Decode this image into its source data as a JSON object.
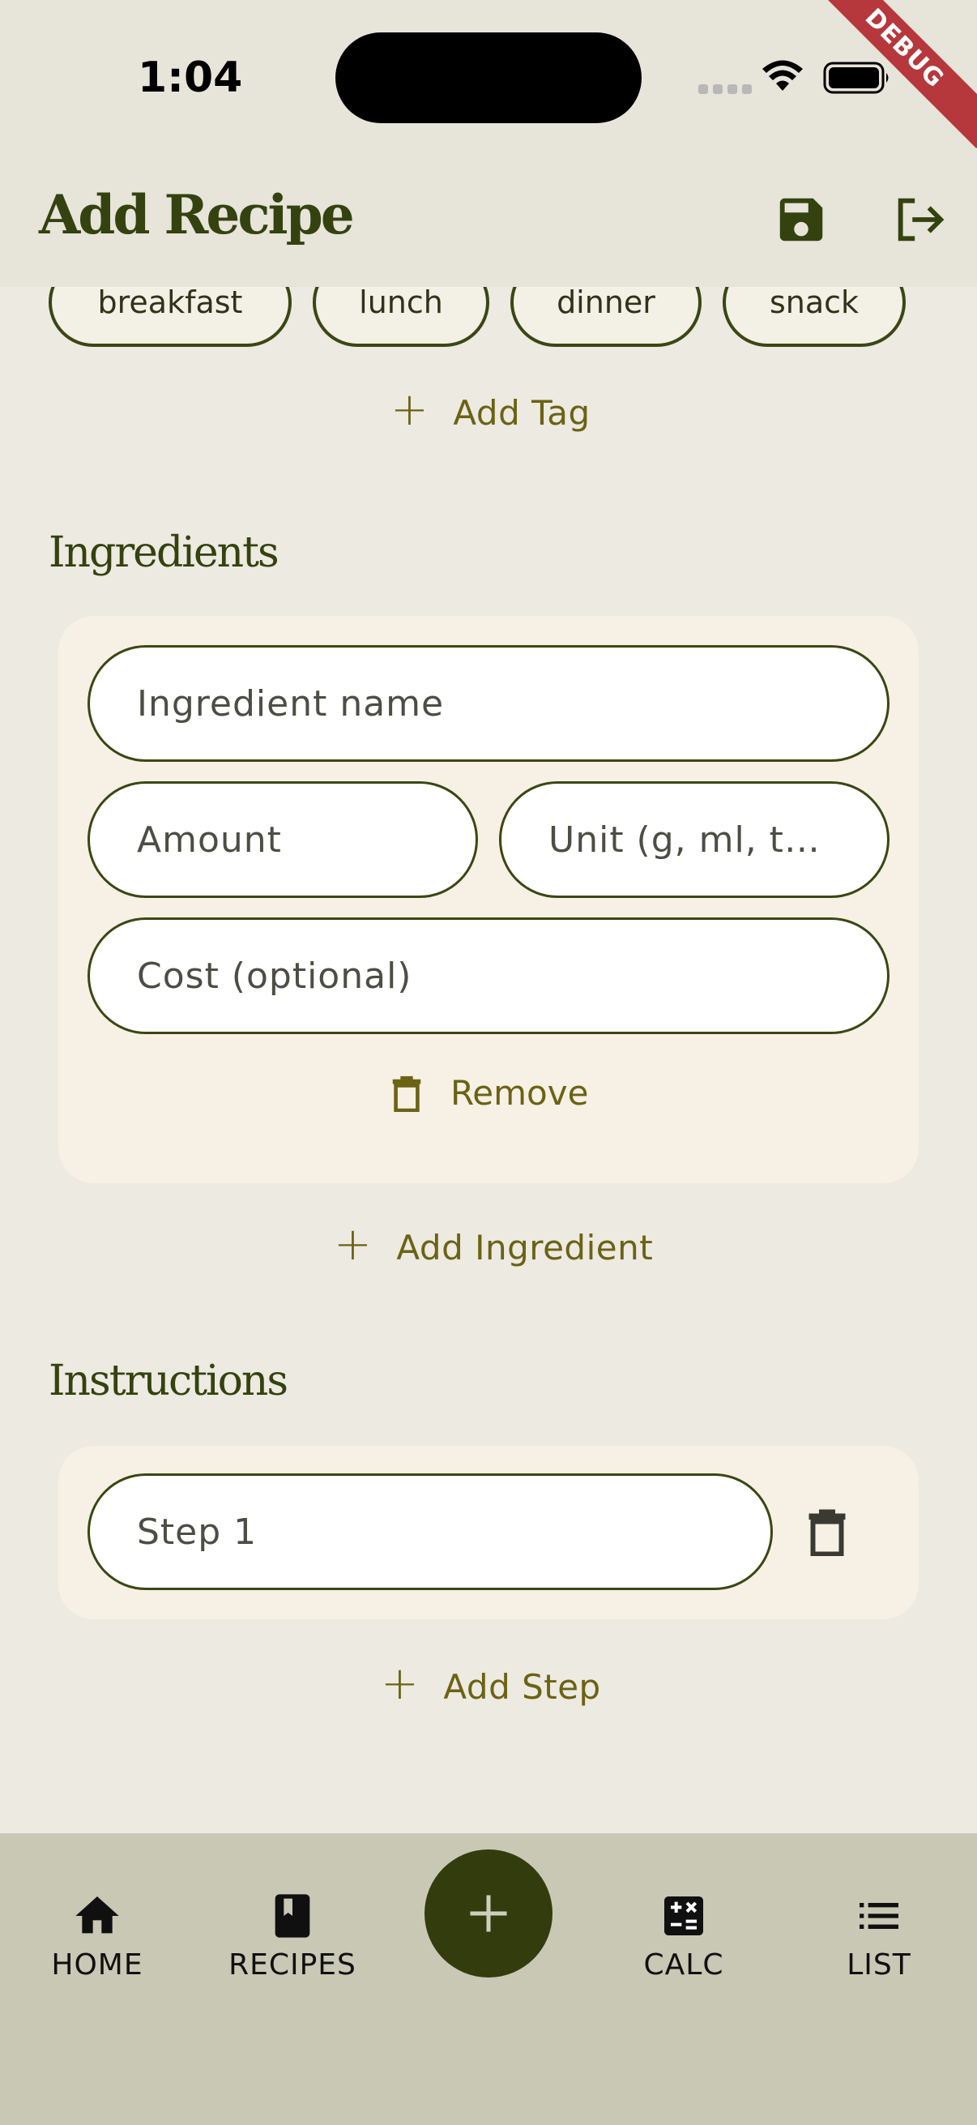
{
  "status_bar": {
    "time": "1:04",
    "debug_label": "DEBUG"
  },
  "app_bar": {
    "title": "Add Recipe",
    "save_icon": "save-icon",
    "logout_icon": "logout-icon"
  },
  "tags": {
    "items": [
      "breakfast",
      "lunch",
      "dinner",
      "snack"
    ],
    "add_label": "Add Tag"
  },
  "ingredients": {
    "title": "Ingredients",
    "name_placeholder": "Ingredient name",
    "amount_placeholder": "Amount",
    "unit_placeholder": "Unit (g, ml, t…",
    "cost_placeholder": "Cost (optional)",
    "remove_label": "Remove",
    "add_label": "Add Ingredient"
  },
  "instructions": {
    "title": "Instructions",
    "step_placeholder": "Step 1",
    "add_label": "Add Step"
  },
  "bottom_nav": {
    "items": [
      {
        "label": "HOME",
        "icon": "home-icon"
      },
      {
        "label": "RECIPES",
        "icon": "book-icon"
      },
      {
        "label": "CALC",
        "icon": "calculator-icon"
      },
      {
        "label": "LIST",
        "icon": "list-icon"
      }
    ],
    "fab_icon": "plus-icon"
  },
  "colors": {
    "accent": "#323c0d",
    "text_button": "#6b6214",
    "background": "#edeae2",
    "nav_background": "#c9c8b5"
  }
}
